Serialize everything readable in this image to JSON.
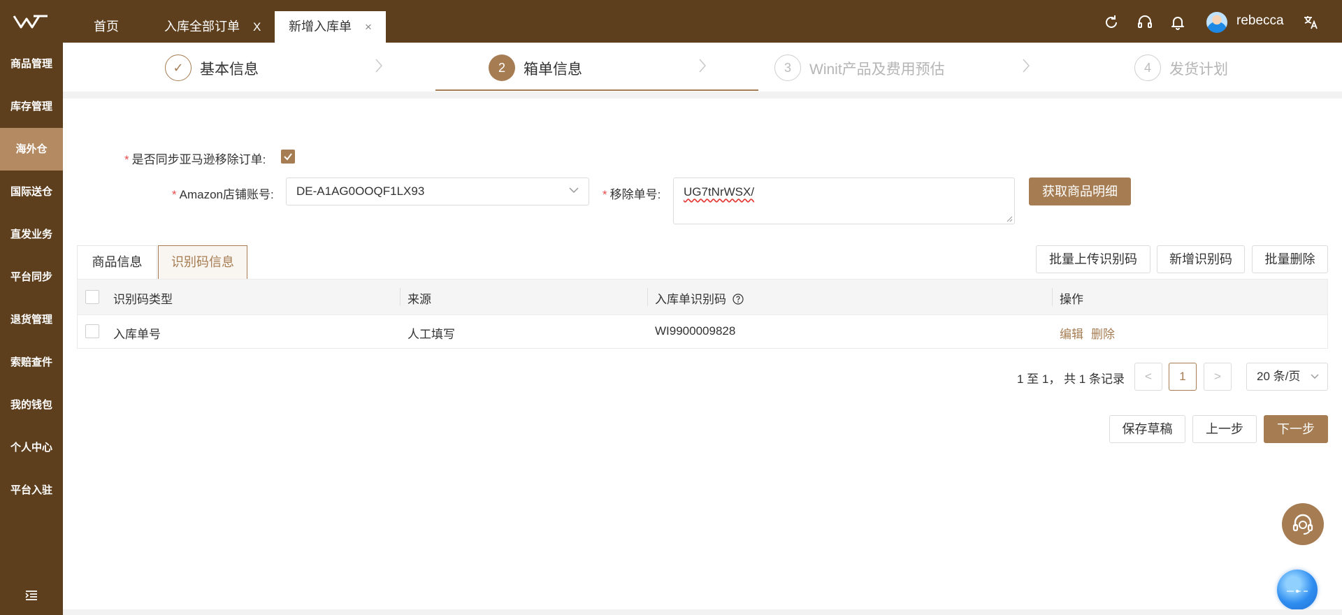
{
  "header": {
    "tabs": [
      {
        "label": "首页",
        "closable": false
      },
      {
        "label": "入库全部订单",
        "closable": true,
        "close_glyph": "X"
      },
      {
        "label": "新增入库单",
        "closable": true,
        "active": true,
        "close_glyph": "×"
      }
    ],
    "username": "rebecca",
    "icons": [
      "refresh-icon",
      "headset-icon",
      "bell-icon",
      "translate-icon"
    ]
  },
  "sidebar": {
    "items": [
      {
        "label": "商品管理"
      },
      {
        "label": "库存管理"
      },
      {
        "label": "海外仓",
        "active": true
      },
      {
        "label": "国际送仓"
      },
      {
        "label": "直发业务"
      },
      {
        "label": "平台同步"
      },
      {
        "label": "退货管理"
      },
      {
        "label": "索赔查件"
      },
      {
        "label": "我的钱包"
      },
      {
        "label": "个人中心"
      },
      {
        "label": "平台入驻"
      }
    ]
  },
  "steps": [
    {
      "number": "✓",
      "label": "基本信息",
      "state": "done"
    },
    {
      "number": "2",
      "label": "箱单信息",
      "state": "current"
    },
    {
      "number": "3",
      "label": "Winit产品及费用预估",
      "state": "todo"
    },
    {
      "number": "4",
      "label": "发货计划",
      "state": "todo"
    }
  ],
  "form": {
    "sync_label": "是否同步亚马逊移除订单:",
    "sync_checked": true,
    "store_label": "Amazon店铺账号:",
    "store_value": "DE-A1AG0OOQF1LX93",
    "removal_label": "移除单号:",
    "removal_value": "UG7tNrWSX/",
    "fetch_button": "获取商品明细",
    "required_mark": "*"
  },
  "subtabs": [
    {
      "label": "商品信息",
      "active": false
    },
    {
      "label": "识别码信息",
      "active": true
    }
  ],
  "table_actions": {
    "batch_upload": "批量上传识别码",
    "add_code": "新增识别码",
    "batch_delete": "批量删除"
  },
  "table": {
    "columns": [
      "识别码类型",
      "来源",
      "入库单识别码",
      "操作"
    ],
    "rows": [
      {
        "type": "入库单号",
        "source": "人工填写",
        "code": "WI9900009828",
        "actions": [
          "编辑",
          "删除"
        ]
      }
    ]
  },
  "pagination": {
    "summary": "1 至 1，  共 1 条记录",
    "prev": "<",
    "current_page": "1",
    "next": ">",
    "page_size": "20 条/页"
  },
  "footer_actions": {
    "save_draft": "保存草稿",
    "prev_step": "上一步",
    "next_step": "下一步"
  },
  "colors": {
    "brand_dark": "#5e3f1d",
    "accent": "#a67c52",
    "sidebar_active": "#b48a62",
    "required": "#e34d4d"
  }
}
